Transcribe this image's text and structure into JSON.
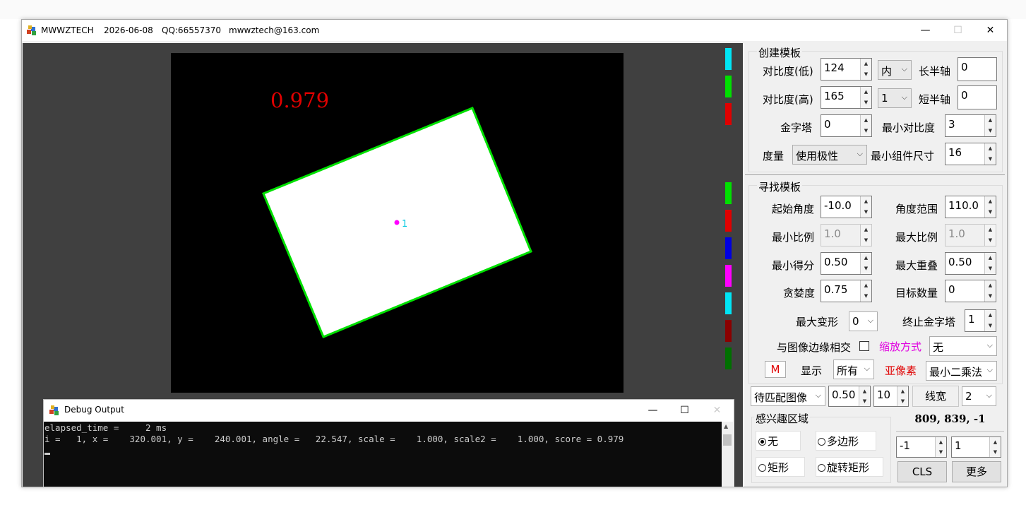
{
  "titlebar": {
    "app_name": "MWWZTECH",
    "date": "2026-06-08",
    "qq": "QQ:66557370",
    "email": "mwwztech@163.com",
    "minimize": "—",
    "maximize": "☐",
    "close": "✕"
  },
  "canvas": {
    "score_text": "0.979",
    "marker_label": "1",
    "score_color": "#e00000",
    "outline_color": "#00e000",
    "marker_color": "#ff00ff"
  },
  "create_template": {
    "title": "创建模板",
    "contrast_low_label": "对比度(低)",
    "contrast_low_value": "124",
    "polarity_option": "内",
    "long_axis_label": "长半轴",
    "long_axis_value": "0",
    "contrast_high_label": "对比度(高)",
    "contrast_high_value": "165",
    "num_option": "1",
    "short_axis_label": "短半轴",
    "short_axis_value": "0",
    "pyramid_label": "金字塔",
    "pyramid_value": "0",
    "min_contrast_label": "最小对比度",
    "min_contrast_value": "3",
    "metric_label": "度量",
    "metric_value": "使用极性",
    "min_component_label": "最小组件尺寸",
    "min_component_value": "16",
    "colors": [
      "#00e5f5",
      "#00e000",
      "#e00000"
    ]
  },
  "find_template": {
    "title": "寻找模板",
    "start_angle_label": "起始角度",
    "start_angle_value": "-10.0",
    "angle_range_label": "角度范围",
    "angle_range_value": "110.0",
    "min_scale_label": "最小比例",
    "min_scale_value": "1.0",
    "max_scale_label": "最大比例",
    "max_scale_value": "1.0",
    "min_score_label": "最小得分",
    "min_score_value": "0.50",
    "max_overlap_label": "最大重叠",
    "max_overlap_value": "0.50",
    "greediness_label": "贪婪度",
    "greediness_value": "0.75",
    "num_targets_label": "目标数量",
    "num_targets_value": "0",
    "max_deform_label": "最大变形",
    "max_deform_value": "0",
    "stop_pyramid_label": "终止金字塔",
    "stop_pyramid_value": "1",
    "border_intersect_label": "与图像边缘相交",
    "scale_mode_label": "缩放方式",
    "scale_mode_value": "无",
    "m_button": "M",
    "display_label": "显示",
    "display_value": "所有",
    "subpixel_label": "亚像素",
    "subpixel_value": "最小二乘法",
    "colors": [
      "#00e000",
      "#e00000",
      "#0000e0",
      "#ff00ff",
      "#00e5f5",
      "#8b0000",
      "#007000"
    ]
  },
  "bottom": {
    "image_select": "待匹配图像",
    "ratio_value": "0.50",
    "count_value": "10",
    "line_width_label": "线宽",
    "line_width_value": "2",
    "roi_title": "感兴趣区域",
    "roi_options": [
      "无",
      "多边形",
      "矩形",
      "旋转矩形"
    ],
    "coords": "809, 839, -1",
    "spin_a": "-1",
    "spin_b": "1",
    "cls_button": "CLS",
    "more_button": "更多"
  },
  "debug": {
    "title": "Debug Output",
    "line1": "elapsed_time =     2 ms",
    "line2": "i =   1, x =    320.001, y =    240.001, angle =   22.547, scale =    1.000, scale2 =    1.000, score = 0.979"
  }
}
